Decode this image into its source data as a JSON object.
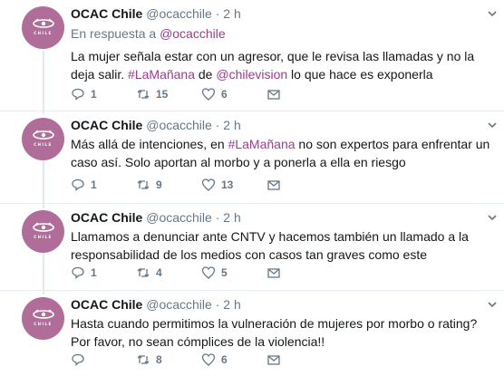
{
  "tweets": [
    {
      "name": "OCAC Chile",
      "handle": "@ocacchile",
      "dot": "·",
      "time": "2 h",
      "reply_prefix": "En respuesta a",
      "reply_to": "@ocacchile",
      "text_a": "La mujer señala estar con un agresor, que le revisa las llamadas y no la deja salir. ",
      "hashtag": "#LaMañana",
      "text_b": " de ",
      "mention": "@chilevision",
      "text_c": " lo que hace es exponerla",
      "replies": "1",
      "retweets": "15",
      "likes": "6"
    },
    {
      "name": "OCAC Chile",
      "handle": "@ocacchile",
      "dot": "·",
      "time": "2 h",
      "text_a": "Más allá de intenciones, en ",
      "hashtag": "#LaMañana",
      "text_b": " no son expertos para enfrentar un caso así. Solo aportan al morbo y a ponerla a ella en riesgo",
      "replies": "1",
      "retweets": "9",
      "likes": "13"
    },
    {
      "name": "OCAC Chile",
      "handle": "@ocacchile",
      "dot": "·",
      "time": "2 h",
      "text_a": "Llamamos a denunciar ante CNTV y hacemos también un llamado a la responsabilidad de los medios con casos tan graves como este",
      "replies": "1",
      "retweets": "4",
      "likes": "5"
    },
    {
      "name": "OCAC Chile",
      "handle": "@ocacchile",
      "dot": "·",
      "time": "2 h",
      "text_a": "Hasta cuando permitimos la vulneración de mujeres por morbo o rating? Por favor, no sean cómplices de la violencia!!",
      "replies": "",
      "retweets": "8",
      "likes": "6"
    }
  ],
  "avatar": {
    "label": "OCAC",
    "subtext": "CHILE",
    "color": "#b16d9a"
  },
  "colors": {
    "link": "#9b3d8e",
    "muted": "#657786",
    "thread_line": "#e1e8ed"
  },
  "icons": [
    "reply-icon",
    "retweet-icon",
    "like-icon",
    "direct-message-icon",
    "caret-down-icon"
  ]
}
